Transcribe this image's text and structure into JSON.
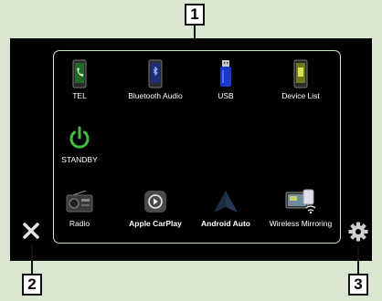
{
  "callouts": {
    "top": "1",
    "bottom_left": "2",
    "bottom_right": "3"
  },
  "sources": [
    {
      "label": "TEL",
      "icon": "phone-icon"
    },
    {
      "label": "Bluetooth Audio",
      "icon": "bluetooth-phone-icon"
    },
    {
      "label": "USB",
      "icon": "usb-drive-icon"
    },
    {
      "label": "Device List",
      "icon": "device-list-icon"
    },
    {
      "label": "STANDBY",
      "icon": "power-icon"
    },
    {
      "label": "Radio",
      "icon": "radio-icon"
    },
    {
      "label": "Apple CarPlay",
      "icon": "apple-carplay-icon"
    },
    {
      "label": "Android Auto",
      "icon": "android-auto-icon"
    },
    {
      "label": "Wireless Mirroring",
      "icon": "wireless-mirroring-icon"
    }
  ],
  "controls": {
    "close_icon": "close-icon",
    "settings_icon": "gear-icon"
  },
  "colors": {
    "background": "#d8e6d2",
    "screen": "#000000",
    "panel_border": "#c9e6c3",
    "standby_green": "#3fc33f"
  }
}
